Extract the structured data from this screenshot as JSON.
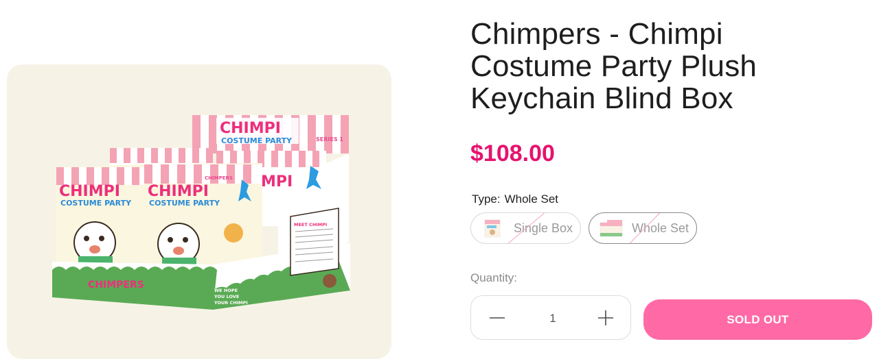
{
  "product": {
    "title": "Chimpers - Chimpi Costume Party Plush Keychain Blind Box",
    "price": "$108.00",
    "image": {
      "box_brand": "CHIMPI",
      "box_subtitle": "COSTUME PARTY",
      "series_label": "SERIES 1",
      "small_brand": "CHIMPERS",
      "tray_logo": "CHIMPERS",
      "tray_slogan_line1": "WE HOPE",
      "tray_slogan_line2": "YOU LOVE",
      "tray_slogan_line3": "YOUR CHIMPI",
      "meet_title": "MEET CHIMPI"
    }
  },
  "variant": {
    "label": "Type:",
    "selected": "Whole Set",
    "options": [
      {
        "label": "Single Box",
        "available": false
      },
      {
        "label": "Whole Set",
        "available": false
      }
    ]
  },
  "quantity": {
    "label": "Quantity:",
    "value": "1",
    "minus_icon": "minus-icon",
    "plus_icon": "plus-icon"
  },
  "cta": {
    "label": "SOLD OUT"
  },
  "colors": {
    "price": "#e5136f",
    "sold_out_button": "#ff6aa6",
    "image_background": "#f6f3e6"
  }
}
